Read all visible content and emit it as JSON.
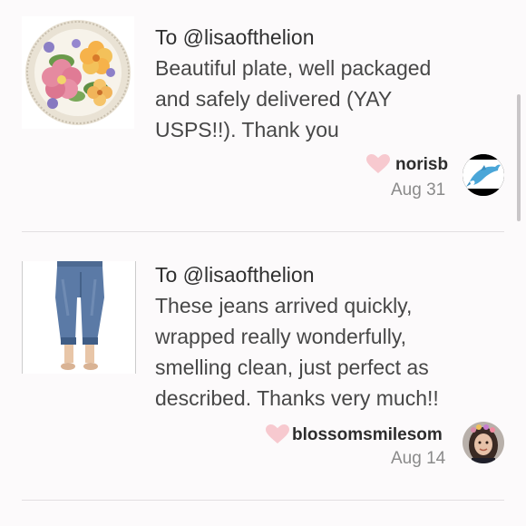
{
  "reviews": [
    {
      "to": "To @lisaofthelion",
      "message": "Beautiful plate, well packaged\nand safely delivered (YAY\nUSPS!!). Thank you",
      "username": "norisb",
      "date": "Aug 31",
      "thumbnail": "floral-plate",
      "avatar": "dolphin"
    },
    {
      "to": "To @lisaofthelion",
      "message": "These jeans arrived quickly,\nwrapped really wonderfully,\nsmelling clean, just perfect as\ndescribed. Thanks very much!!",
      "username": "blossomsmilesom",
      "date": "Aug 14",
      "thumbnail": "cropped-jeans",
      "avatar": "woman-portrait"
    }
  ],
  "colors": {
    "heart": "#f7c9cf",
    "background": "#fcfafb",
    "divider": "#e2dfe1"
  }
}
